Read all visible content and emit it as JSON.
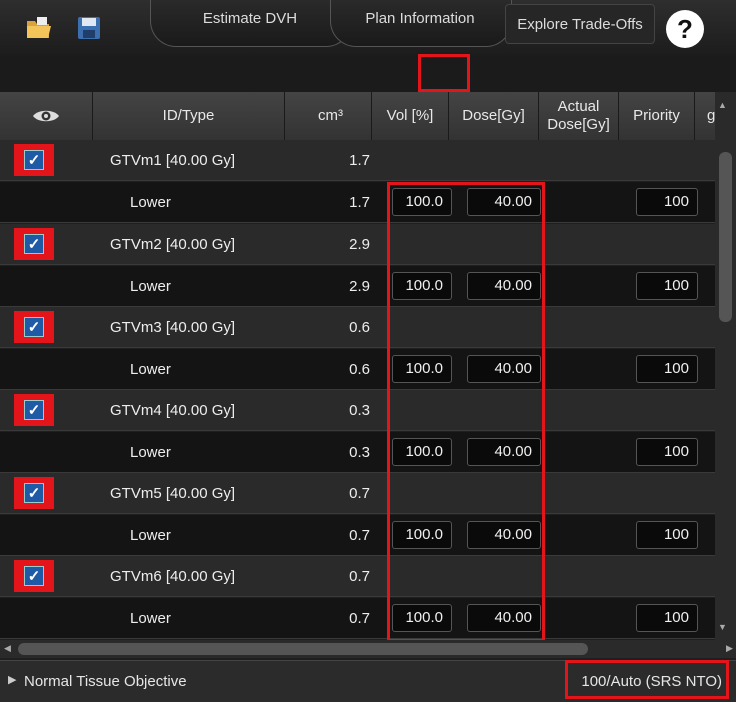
{
  "tabs": [
    {
      "label": "Estimate DVH"
    },
    {
      "label": "Plan Information"
    },
    {
      "label": "Explore Trade-Offs"
    }
  ],
  "help_label": "?",
  "table": {
    "headers": {
      "visibility_icon": "eye-icon",
      "id_type": "ID/Type",
      "cm3": "cm³",
      "vol": "Vol [%]",
      "dose": "Dose[Gy]",
      "actual_dose": "Actual Dose[Gy]",
      "priority": "Priority",
      "g": "g"
    },
    "structures": [
      {
        "name": "GTVm1 [40.00 Gy]",
        "cm3": "1.7",
        "checked": true,
        "constraint": {
          "type": "Lower",
          "cm3": "1.7",
          "vol": "100.0",
          "dose": "40.00",
          "priority": "100"
        }
      },
      {
        "name": "GTVm2 [40.00 Gy]",
        "cm3": "2.9",
        "checked": true,
        "constraint": {
          "type": "Lower",
          "cm3": "2.9",
          "vol": "100.0",
          "dose": "40.00",
          "priority": "100"
        }
      },
      {
        "name": "GTVm3 [40.00 Gy]",
        "cm3": "0.6",
        "checked": true,
        "constraint": {
          "type": "Lower",
          "cm3": "0.6",
          "vol": "100.0",
          "dose": "40.00",
          "priority": "100"
        }
      },
      {
        "name": "GTVm4 [40.00 Gy]",
        "cm3": "0.3",
        "checked": true,
        "constraint": {
          "type": "Lower",
          "cm3": "0.3",
          "vol": "100.0",
          "dose": "40.00",
          "priority": "100"
        }
      },
      {
        "name": "GTVm5 [40.00 Gy]",
        "cm3": "0.7",
        "checked": true,
        "constraint": {
          "type": "Lower",
          "cm3": "0.7",
          "vol": "100.0",
          "dose": "40.00",
          "priority": "100"
        }
      },
      {
        "name": "GTVm6 [40.00 Gy]",
        "cm3": "0.7",
        "checked": true,
        "constraint": {
          "type": "Lower",
          "cm3": "0.7",
          "vol": "100.0",
          "dose": "40.00",
          "priority": "100"
        }
      }
    ]
  },
  "footer": {
    "label": "Normal Tissue Objective",
    "value": "100/Auto (SRS NTO)"
  },
  "colors": {
    "highlight": "#e4141b",
    "checkbox": "#1e5aa6"
  }
}
